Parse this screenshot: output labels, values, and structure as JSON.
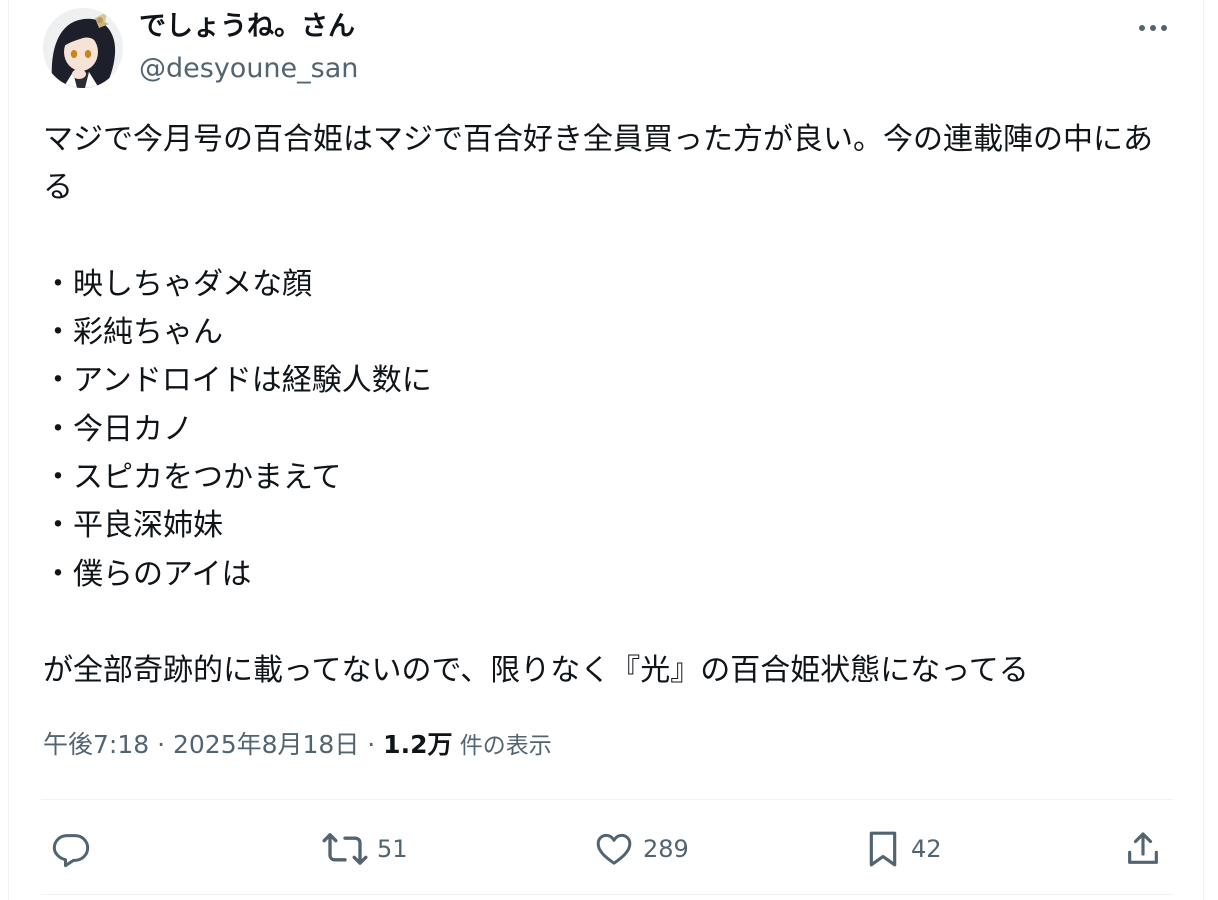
{
  "author": {
    "display_name": "でしょうね。さん",
    "handle": "@desyoune_san"
  },
  "tweet": {
    "intro": "マジで今月号の百合姫はマジで百合好き全員買った方が良い。今の連載陣の中にある",
    "items": [
      "・映しちゃダメな顔",
      "・彩純ちゃん",
      "・アンドロイドは経験人数に",
      "・今日カノ",
      "・スピカをつかまえて",
      "・平良深姉妹",
      "・僕らのアイは"
    ],
    "outro": "が全部奇跡的に載ってないので、限りなく『光』の百合姫状態になってる"
  },
  "meta": {
    "time": "午後7:18",
    "sep1": " · ",
    "date": "2025年8月18日",
    "sep2": " · ",
    "views": "1.2万",
    "views_label": " 件の表示"
  },
  "actions": {
    "reply_count": "",
    "retweet_count": "51",
    "like_count": "289",
    "bookmark_count": "42"
  },
  "icons": {
    "more": "more-horizontal-icon",
    "reply": "reply-icon",
    "retweet": "retweet-icon",
    "like": "heart-icon",
    "bookmark": "bookmark-icon",
    "share": "share-icon"
  },
  "colors": {
    "text": "#0f1419",
    "secondary": "#536471",
    "divider": "#eff3f4"
  }
}
